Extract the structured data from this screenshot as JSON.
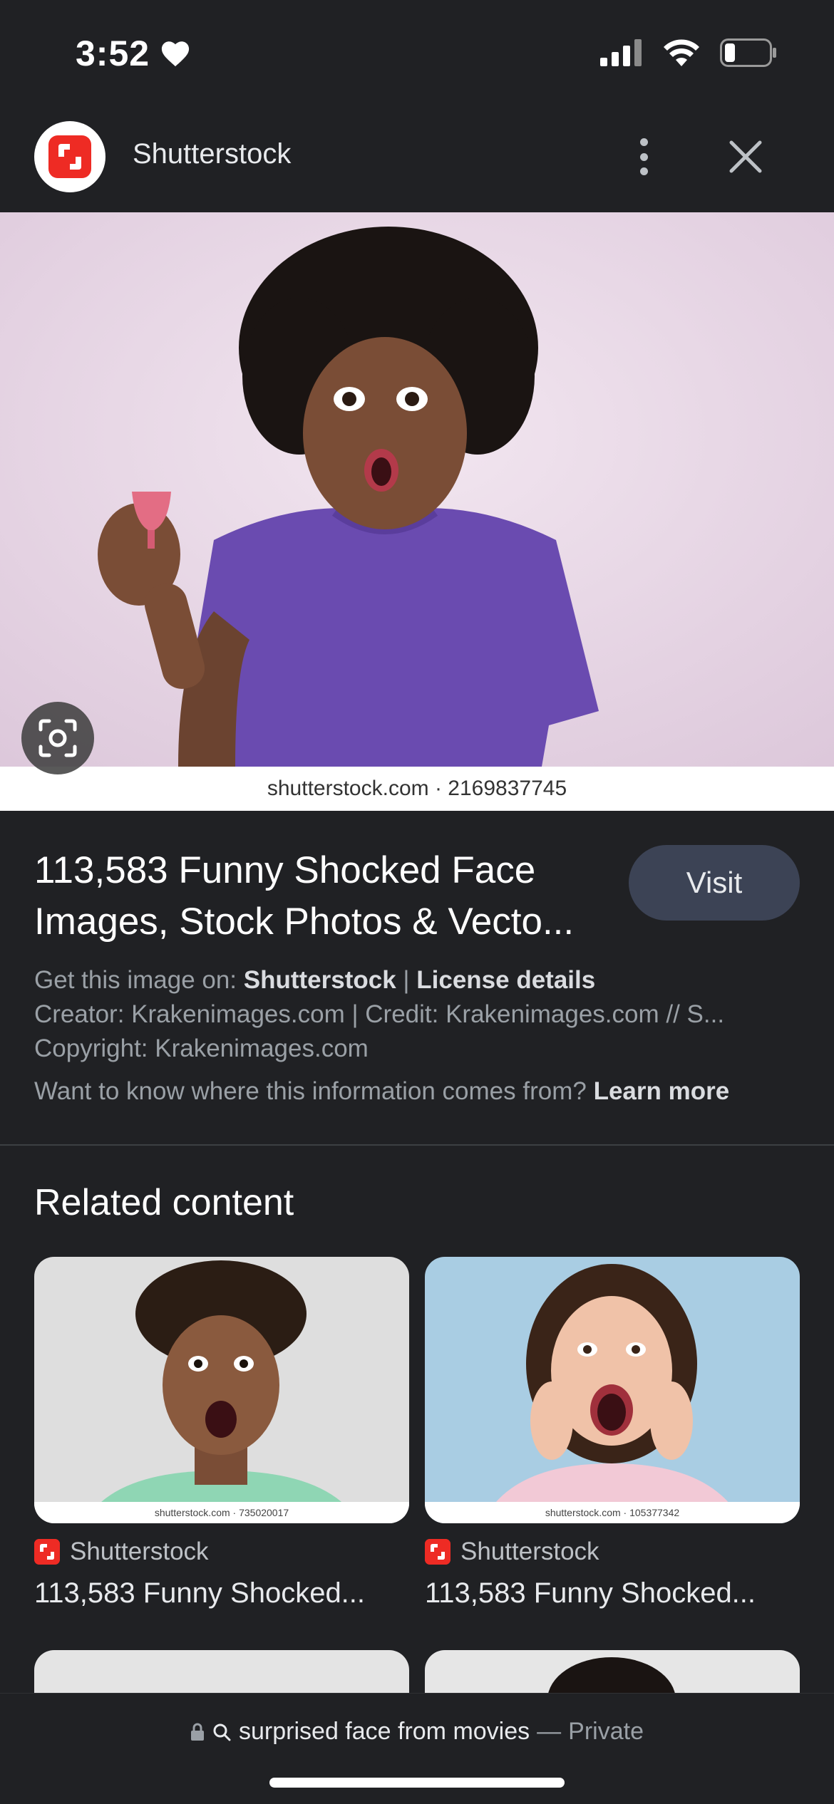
{
  "status": {
    "time": "3:52"
  },
  "header": {
    "site_name": "Shutterstock"
  },
  "hero": {
    "caption": "shutterstock.com · 2169837745"
  },
  "info": {
    "title_line1": "113,583 Funny Shocked Face",
    "title_line2": "Images, Stock Photos & Vecto...",
    "visit_label": "Visit",
    "get_image_prefix": "Get this image on: ",
    "get_image_source": "Shutterstock",
    "separator": " | ",
    "license_details": "License details",
    "creator_line": "Creator: Krakenimages.com | Credit: Krakenimages.com // S...",
    "copyright_line": "Copyright: Krakenimages.com",
    "learn_prefix": "Want to know where this information comes from? ",
    "learn_more": "Learn more"
  },
  "related": {
    "heading": "Related content",
    "items": [
      {
        "source": "Shutterstock",
        "title": "113,583 Funny Shocked...",
        "caption": "shutterstock.com · 735020017"
      },
      {
        "source": "Shutterstock",
        "title": "113,583 Funny Shocked...",
        "caption": "shutterstock.com · 105377342"
      }
    ]
  },
  "bottom": {
    "query": "surprised face from movies",
    "dash": "—",
    "private": "Private"
  },
  "colors": {
    "background": "#202124",
    "brand_red": "#ee2b24",
    "visit_button": "#3c4355"
  },
  "icons": [
    "heart-icon",
    "signal-icon",
    "wifi-icon",
    "battery-icon",
    "kebab-menu-icon",
    "close-icon",
    "lens-icon",
    "lock-icon",
    "search-icon"
  ]
}
